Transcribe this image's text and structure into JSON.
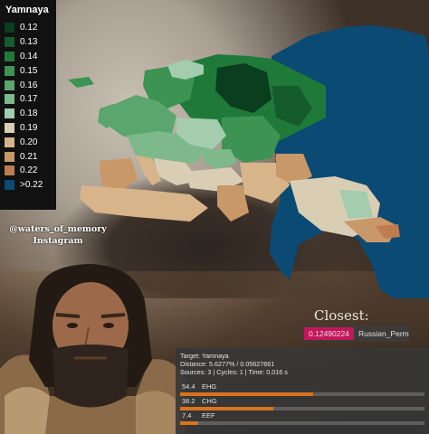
{
  "legend": {
    "title": "Yamnaya",
    "items": [
      {
        "label": "0.12",
        "color": "#0b3d1f"
      },
      {
        "label": "0.13",
        "color": "#155c2c"
      },
      {
        "label": "0.14",
        "color": "#1f7a3a"
      },
      {
        "label": "0.15",
        "color": "#3c9352"
      },
      {
        "label": "0.16",
        "color": "#5aa66e"
      },
      {
        "label": "0.17",
        "color": "#7db98b"
      },
      {
        "label": "0.18",
        "color": "#a4ccae"
      },
      {
        "label": "0.19",
        "color": "#d9cdb4"
      },
      {
        "label": "0.20",
        "color": "#d7b48a"
      },
      {
        "label": "0.21",
        "color": "#c99868"
      },
      {
        "label": "0.22",
        "color": "#bf7c4e"
      },
      {
        "label": ">0.22",
        "color": "#0b4a73"
      }
    ]
  },
  "credit": {
    "handle": "@waters_of_memory",
    "platform": "Instagram"
  },
  "closest": {
    "title": "Closest:",
    "value": "0.12490224",
    "population": "Russian_Perm"
  },
  "panel": {
    "target": "Target: Yamnaya",
    "distance": "Distance: 5.6277% / 0.05627661",
    "stats": "Sources: 3 | Cycles: 1 | Time: 0.016 s",
    "components": [
      {
        "value": "54.4",
        "name": "EHG",
        "fraction": 0.544
      },
      {
        "value": "38.2",
        "name": "CHG",
        "fraction": 0.382
      },
      {
        "value": "7.4",
        "name": "EEF",
        "fraction": 0.074
      }
    ]
  }
}
